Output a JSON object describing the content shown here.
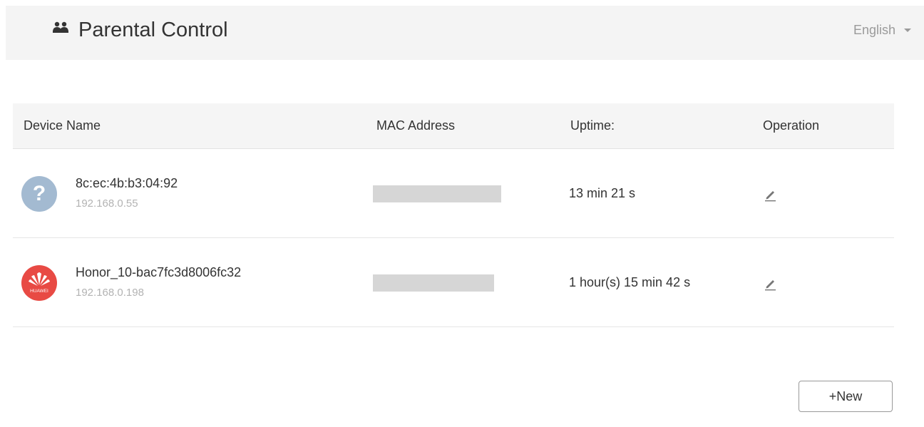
{
  "header": {
    "title": "Parental Control",
    "language": "English"
  },
  "table": {
    "columns": [
      "Device Name",
      "MAC Address",
      "Uptime:",
      "Operation"
    ],
    "rows": [
      {
        "device_name": "8c:ec:4b:b3:04:92",
        "ip": "192.168.0.55",
        "uptime": "13 min 21 s",
        "avatar": "unknown-device-icon"
      },
      {
        "device_name": "Honor_10-bac7fc3d8006fc32",
        "ip": "192.168.0.198",
        "uptime": "1 hour(s) 15 min 42 s",
        "avatar": "huawei-logo-icon",
        "avatar_text": "HUAWEI"
      }
    ]
  },
  "actions": {
    "new_label": "+New"
  },
  "colors": {
    "huawei_red": "#e84a44",
    "unknown_avatar": "#a3bad1",
    "header_bg": "#f4f4f4"
  }
}
